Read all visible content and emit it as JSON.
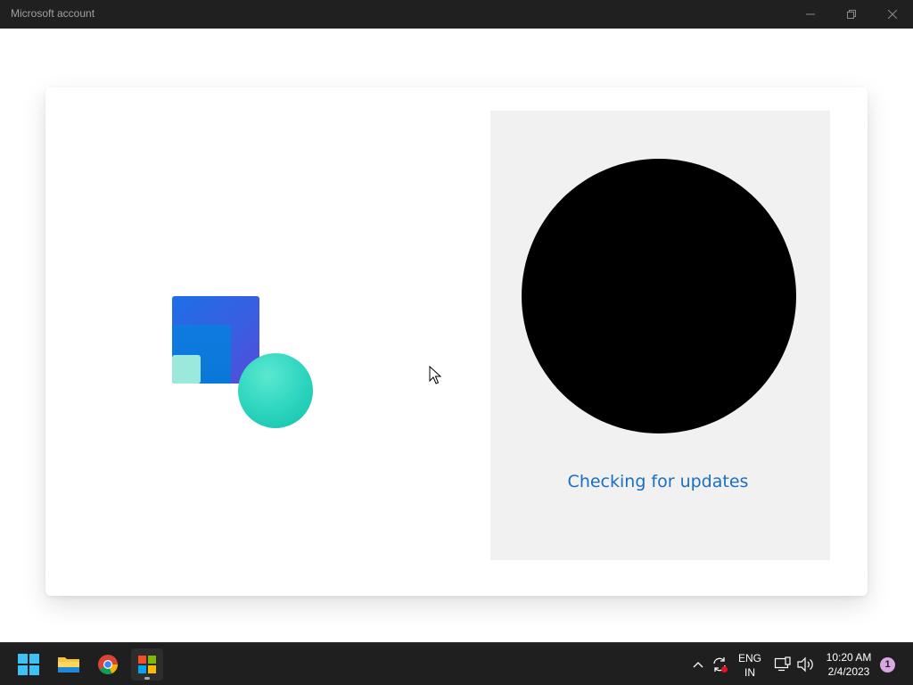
{
  "window": {
    "title": "Microsoft account",
    "controls": [
      "minimize-icon",
      "restore-icon",
      "close-icon"
    ]
  },
  "main": {
    "hero_icon": "microsoft-account-illustration",
    "status_text": "Checking for updates",
    "status_color": "#1a6fbf"
  },
  "taskbar": {
    "apps": [
      {
        "name": "start",
        "icon": "windows-logo-icon"
      },
      {
        "name": "file-explorer",
        "icon": "folder-icon"
      },
      {
        "name": "chrome",
        "icon": "chrome-icon"
      },
      {
        "name": "microsoft-store",
        "icon": "store-icon",
        "active": true
      }
    ],
    "tray": {
      "language_line1": "ENG",
      "language_line2": "IN",
      "time": "10:20 AM",
      "date": "2/4/2023",
      "notification_count": "1"
    }
  }
}
